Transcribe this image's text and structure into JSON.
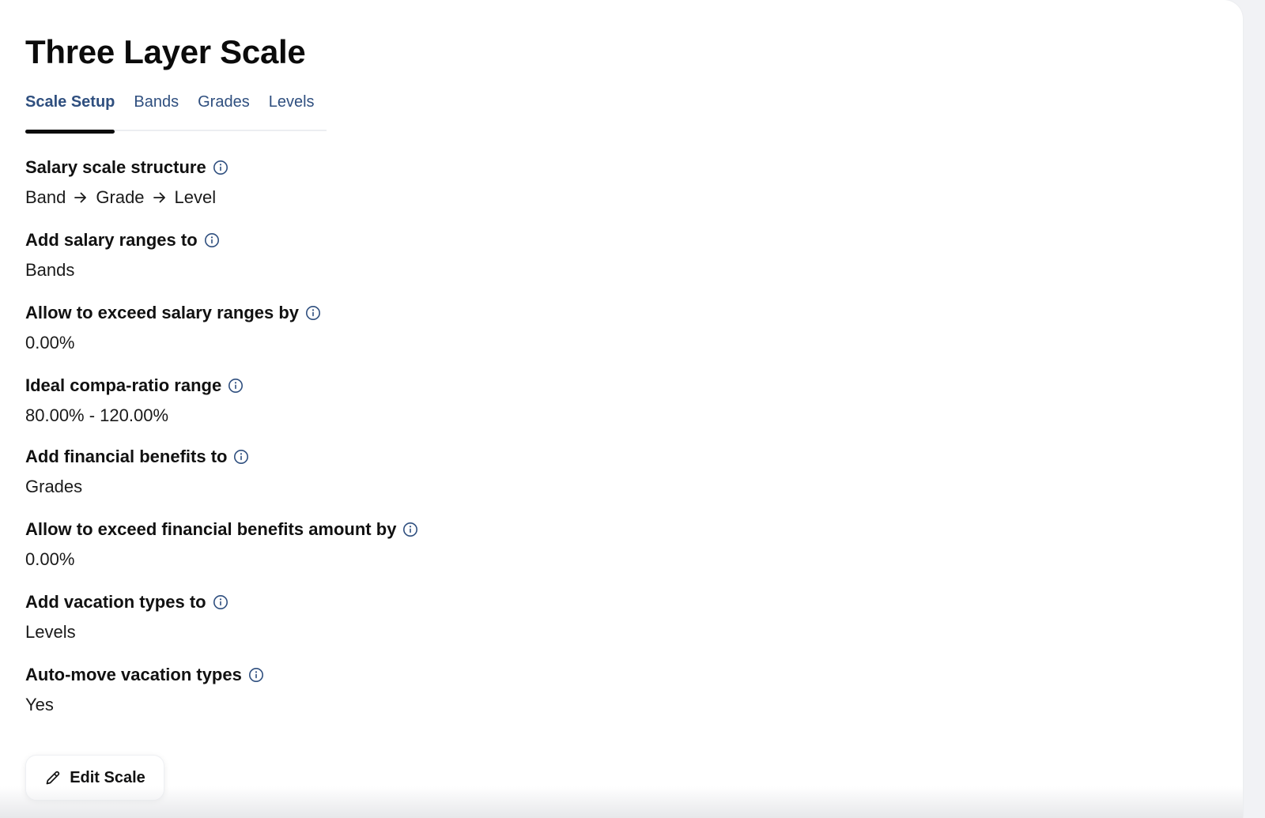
{
  "page": {
    "title": "Three Layer Scale"
  },
  "tabs": [
    {
      "label": "Scale Setup",
      "active": true
    },
    {
      "label": "Bands",
      "active": false
    },
    {
      "label": "Grades",
      "active": false
    },
    {
      "label": "Levels",
      "active": false
    }
  ],
  "fields": {
    "structure": {
      "label": "Salary scale structure",
      "parts": [
        "Band",
        "Grade",
        "Level"
      ]
    },
    "salary_ranges_to": {
      "label": "Add salary ranges to",
      "value": "Bands"
    },
    "exceed_salary": {
      "label": "Allow to exceed salary ranges by",
      "value": "0.00%"
    },
    "compa_ratio": {
      "label": "Ideal compa-ratio range",
      "value": "80.00% - 120.00%"
    },
    "benefits_to": {
      "label": "Add financial benefits to",
      "value": "Grades"
    },
    "exceed_benefits": {
      "label": "Allow to exceed financial benefits amount by",
      "value": "0.00%"
    },
    "vacation_to": {
      "label": "Add vacation types to",
      "value": "Levels"
    },
    "auto_move": {
      "label": "Auto-move vacation types",
      "value": "Yes"
    }
  },
  "actions": {
    "edit_label": "Edit Scale"
  },
  "icons": {
    "info": "info-icon",
    "arrow": "arrow-right-icon",
    "edit": "pencil-icon"
  },
  "colors": {
    "tab_text": "#2f4f7f",
    "info_icon": "#2f4f7f",
    "title": "#0b0b0b"
  }
}
